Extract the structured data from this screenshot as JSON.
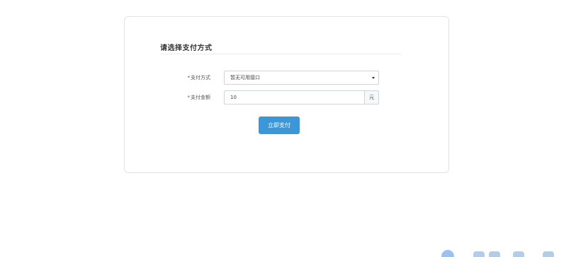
{
  "section": {
    "title": "请选择支付方式"
  },
  "form": {
    "method": {
      "required_mark": "*",
      "label": "支付方式",
      "selected": "暂无可用接口"
    },
    "amount": {
      "required_mark": "*",
      "label": "支付金额",
      "value": "10",
      "unit": "元"
    },
    "submit_label": "立即支付"
  },
  "colors": {
    "accent": "#3b97d7",
    "border": "#cfd4da"
  },
  "icons": {
    "select_caret": "caret-down-icon",
    "watermark_logo": "watermark-logo-icon"
  }
}
